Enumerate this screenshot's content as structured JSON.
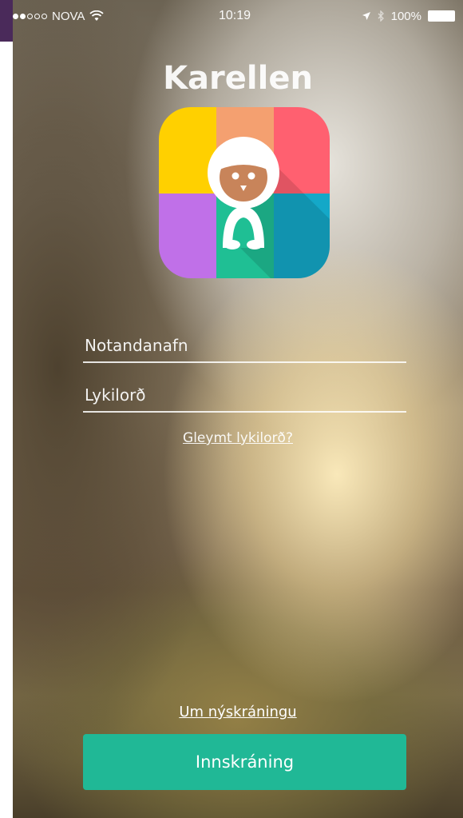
{
  "status_bar": {
    "carrier": "NOVA",
    "time": "10:19",
    "battery": "100%"
  },
  "app": {
    "title": "Karellen"
  },
  "login": {
    "username_placeholder": "Notandanafn",
    "password_placeholder": "Lykilorð",
    "forgot_password_label": "Gleymt lykilorð?",
    "register_info_label": "Um nýskráningu",
    "submit_label": "Innskráning"
  },
  "colors": {
    "primary_button": "#20b896",
    "logo_yellow": "#ffd000",
    "logo_orange": "#f4a070",
    "logo_red": "#ff6070",
    "logo_purple": "#c070e8",
    "logo_green": "#1fbf94",
    "logo_blue": "#14a8c8"
  }
}
